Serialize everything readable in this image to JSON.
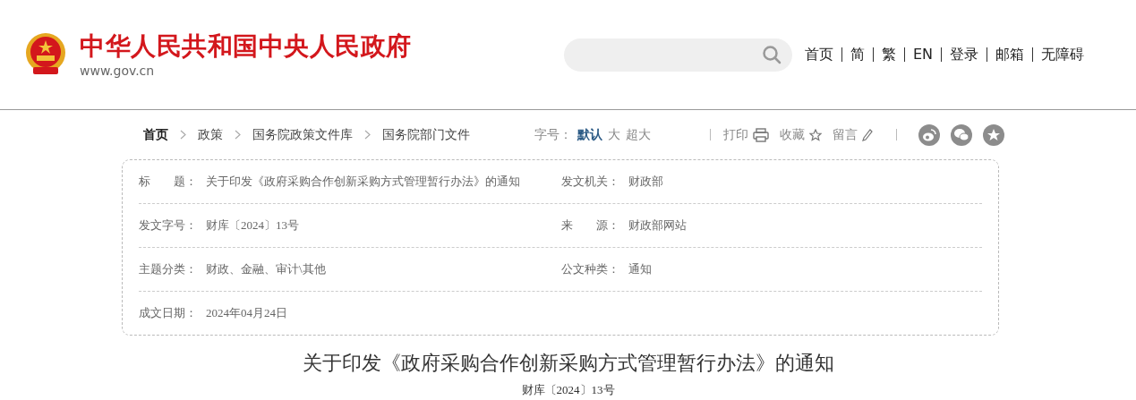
{
  "header": {
    "site_name": "中华人民共和国中央人民政府",
    "domain": "www.gov.cn",
    "nav": [
      "首页",
      "简",
      "繁",
      "EN",
      "登录",
      "邮箱",
      "无障碍"
    ]
  },
  "breadcrumb": [
    "首页",
    "政策",
    "国务院政策文件库",
    "国务院部门文件"
  ],
  "font_size": {
    "label": "字号：",
    "options": [
      {
        "label": "默认",
        "selected": true
      },
      {
        "label": "大",
        "selected": false
      },
      {
        "label": "超大",
        "selected": false
      }
    ]
  },
  "tools": [
    {
      "kind": "print",
      "label": "打印"
    },
    {
      "kind": "favorite",
      "label": "收藏"
    },
    {
      "kind": "comment",
      "label": "留言"
    }
  ],
  "share": [
    {
      "kind": "weibo"
    },
    {
      "kind": "wechat"
    },
    {
      "kind": "favorite"
    }
  ],
  "info": [
    [
      {
        "label": "标　　题：",
        "value": "关于印发《政府采购合作创新采购方式管理暂行办法》的通知"
      },
      {
        "label": "发文机关：",
        "value": "财政部"
      }
    ],
    [
      {
        "label": "发文字号：",
        "value": "财库〔2024〕13号"
      },
      {
        "label": "来　　源：",
        "value": "财政部网站"
      }
    ],
    [
      {
        "label": "主题分类：",
        "value": "财政、金融、审计\\其他"
      },
      {
        "label": "公文种类：",
        "value": "通知"
      }
    ],
    [
      {
        "label": "成文日期：",
        "value": "2024年04月24日"
      }
    ]
  ],
  "article": {
    "title": "关于印发《政府采购合作创新采购方式管理暂行办法》的通知",
    "doc_number": "财库〔2024〕13号"
  }
}
